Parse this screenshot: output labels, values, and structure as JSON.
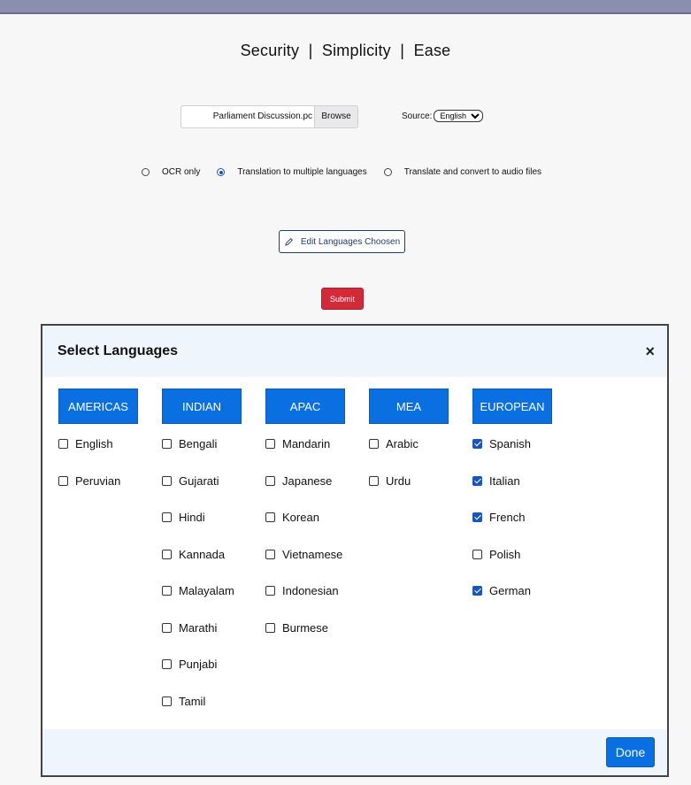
{
  "tagline": "Security  |  Simplicity  |  Ease",
  "upload": {
    "file_name": "Parliament Discussion.pc",
    "browse_label": "Browse"
  },
  "source": {
    "label": "Source:",
    "selected": "English"
  },
  "modes": [
    {
      "label": "OCR only",
      "checked": false
    },
    {
      "label": "Translation to multiple languages",
      "checked": true
    },
    {
      "label": "Translate and convert to audio files",
      "checked": false
    }
  ],
  "edit_button": "Edit Languages Choosen",
  "submit_button": "Submit",
  "modal": {
    "title": "Select Languages",
    "close": "×",
    "done": "Done",
    "regions": [
      {
        "name": "AMERICAS",
        "languages": [
          {
            "label": "English",
            "checked": false
          },
          {
            "label": "Peruvian",
            "checked": false
          }
        ]
      },
      {
        "name": "INDIAN",
        "languages": [
          {
            "label": "Bengali",
            "checked": false
          },
          {
            "label": "Gujarati",
            "checked": false
          },
          {
            "label": "Hindi",
            "checked": false
          },
          {
            "label": "Kannada",
            "checked": false
          },
          {
            "label": "Malayalam",
            "checked": false
          },
          {
            "label": "Marathi",
            "checked": false
          },
          {
            "label": "Punjabi",
            "checked": false
          },
          {
            "label": "Tamil",
            "checked": false
          }
        ]
      },
      {
        "name": "APAC",
        "languages": [
          {
            "label": "Mandarin",
            "checked": false
          },
          {
            "label": "Japanese",
            "checked": false
          },
          {
            "label": "Korean",
            "checked": false
          },
          {
            "label": "Vietnamese",
            "checked": false
          },
          {
            "label": "Indonesian",
            "checked": false
          },
          {
            "label": "Burmese",
            "checked": false
          }
        ]
      },
      {
        "name": "MEA",
        "languages": [
          {
            "label": "Arabic",
            "checked": false
          },
          {
            "label": "Urdu",
            "checked": false
          }
        ]
      },
      {
        "name": "EUROPEAN",
        "languages": [
          {
            "label": "Spanish",
            "checked": true
          },
          {
            "label": "Italian",
            "checked": true
          },
          {
            "label": "French",
            "checked": true
          },
          {
            "label": "Polish",
            "checked": false
          },
          {
            "label": "German",
            "checked": true
          }
        ]
      }
    ]
  }
}
